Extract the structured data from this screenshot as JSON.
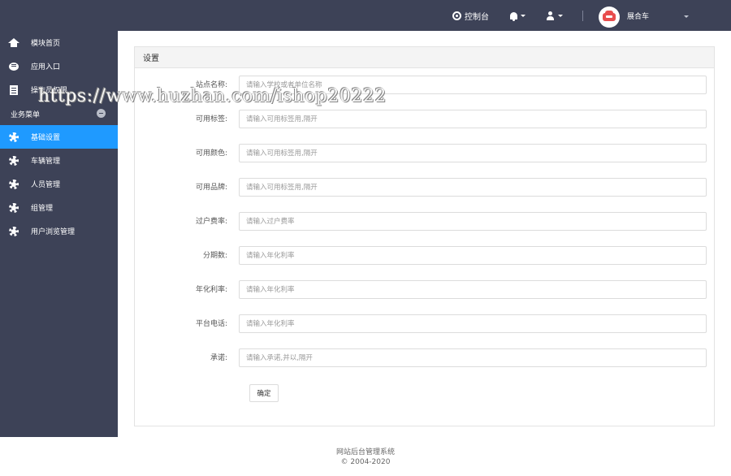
{
  "topbar": {
    "console_label": "控制台",
    "user_name": "展合车"
  },
  "sidebar": {
    "items_top": [
      {
        "label": "模块首页",
        "icon": "home-icon"
      },
      {
        "label": "应用入口",
        "icon": "chat-icon"
      },
      {
        "label": "操作员权限",
        "icon": "document-icon"
      }
    ],
    "section_label": "业务菜单",
    "items_business": [
      {
        "label": "基础设置",
        "icon": "gear-icon",
        "active": true
      },
      {
        "label": "车辆管理",
        "icon": "gear-icon"
      },
      {
        "label": "人员管理",
        "icon": "gear-icon"
      },
      {
        "label": "组管理",
        "icon": "gear-icon"
      },
      {
        "label": "用户浏览管理",
        "icon": "gear-icon"
      }
    ]
  },
  "panel": {
    "title": "设置",
    "fields": [
      {
        "label": "站点名称:",
        "placeholder": "请输入学校或者单位名称"
      },
      {
        "label": "可用标签:",
        "placeholder": "请输入可用标签用,隔开"
      },
      {
        "label": "可用颜色:",
        "placeholder": "请输入可用标签用,隔开"
      },
      {
        "label": "可用品牌:",
        "placeholder": "请输入可用标签用,隔开"
      },
      {
        "label": "过户费率:",
        "placeholder": "请输入过户费率"
      },
      {
        "label": "分期数:",
        "placeholder": "请输入年化利率"
      },
      {
        "label": "年化利率:",
        "placeholder": "请输入年化利率"
      },
      {
        "label": "平台电话:",
        "placeholder": "请输入年化利率"
      },
      {
        "label": "承诺:",
        "placeholder": "请输入承诺,并以,隔开"
      }
    ],
    "submit_label": "确定"
  },
  "footer": {
    "system_name": "网站后台管理系统",
    "copyright": "© 2004-2020"
  },
  "watermark": "https://www.huzhan.com/ishop20222",
  "colors": {
    "topbar_bg": "#3d4257",
    "sidebar_bg": "#3d4257",
    "active_item": "#1f9aff",
    "avatar_car": "#e84d4d"
  }
}
